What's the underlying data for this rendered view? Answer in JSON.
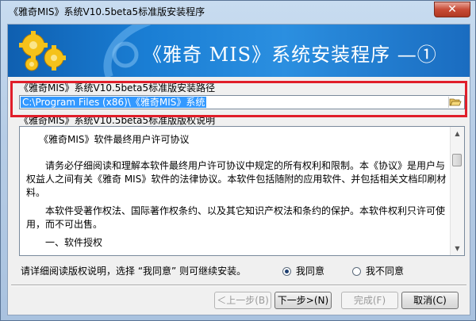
{
  "window": {
    "title": "《雅奇MIS》系统V10.5beta5标准版安装程序",
    "close_label": "✕"
  },
  "banner": {
    "title": "《雅奇 MIS》系统安装程序 —①"
  },
  "install_path": {
    "label": "《雅奇MIS》系统V10.5beta5标准版安装路径",
    "value": "C:\\Program Files (x86)\\《雅奇MIS》系统"
  },
  "license": {
    "label": "《雅奇MIS》系统V10.5beta5标准版版权说明",
    "paragraphs": [
      "《雅奇MIS》软件最终用户许可协议",
      "请务必仔细阅读和理解本软件最终用户许可协议中规定的所有权利和限制。本《协议》是用户与权益人之间有关《雅奇 MIS》软件的法律协议。本软件包括随附的应用软件、并包括相关文档印刷材料。",
      "本软件受著作权法、国际著作权条约、以及其它知识产权法和条约的保护。本软件权利只许可使用，而不可出售。",
      "一、软件授权"
    ]
  },
  "agreement": {
    "prompt": "请详细阅读版权说明，选择 “我同意” 则可继续安装。",
    "agree_label": "我同意",
    "disagree_label": "我不同意",
    "selected": "agree"
  },
  "buttons": {
    "back": "＜上一步(B)",
    "next": "下一步>(N)",
    "finish": "完成(F)",
    "cancel": "取消(C)"
  }
}
